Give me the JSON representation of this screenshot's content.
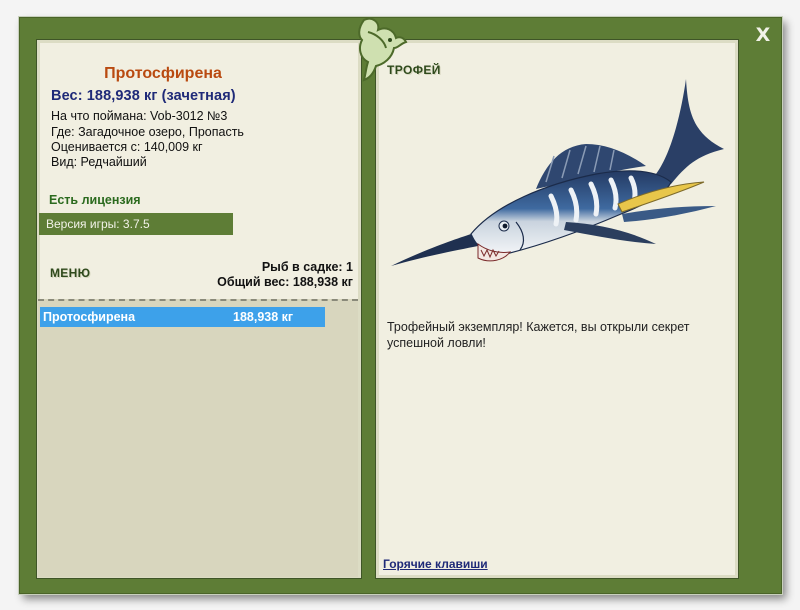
{
  "window": {
    "close_label": "X"
  },
  "catch": {
    "title": "Протосфирена",
    "weight": "Вес: 188,938 кг (зачетная)",
    "bait": "На что поймана: Vob-3012 №3",
    "location": "Где: Загадочное озеро, Пропасть",
    "valued": "Оценивается с: 140,009 кг",
    "rarity": "Вид: Редчайший"
  },
  "license": "Есть лицензия",
  "version": "Версия игры: 3.7.5",
  "menu_label": "МЕНЮ",
  "stats": {
    "count": "Рыб в садке: 1",
    "total": "Общий вес: 188,938 кг"
  },
  "keepnet": [
    {
      "name": "Протосфирена",
      "weight": "188,938 кг"
    }
  ],
  "trophy": {
    "label": "ТРОФЕЙ",
    "text": "Трофейный экземпляр! Кажется, вы открыли секрет успешной ловли!"
  },
  "hotkeys_label": "Горячие клавиши",
  "icons": {
    "logo": "fish-logo-icon",
    "close": "close-icon"
  },
  "colors": {
    "frame": "#5e7d36",
    "panel": "#f1efe1",
    "title": "#b94a10",
    "weight": "#1f2a78",
    "selection": "#3da1ea"
  }
}
